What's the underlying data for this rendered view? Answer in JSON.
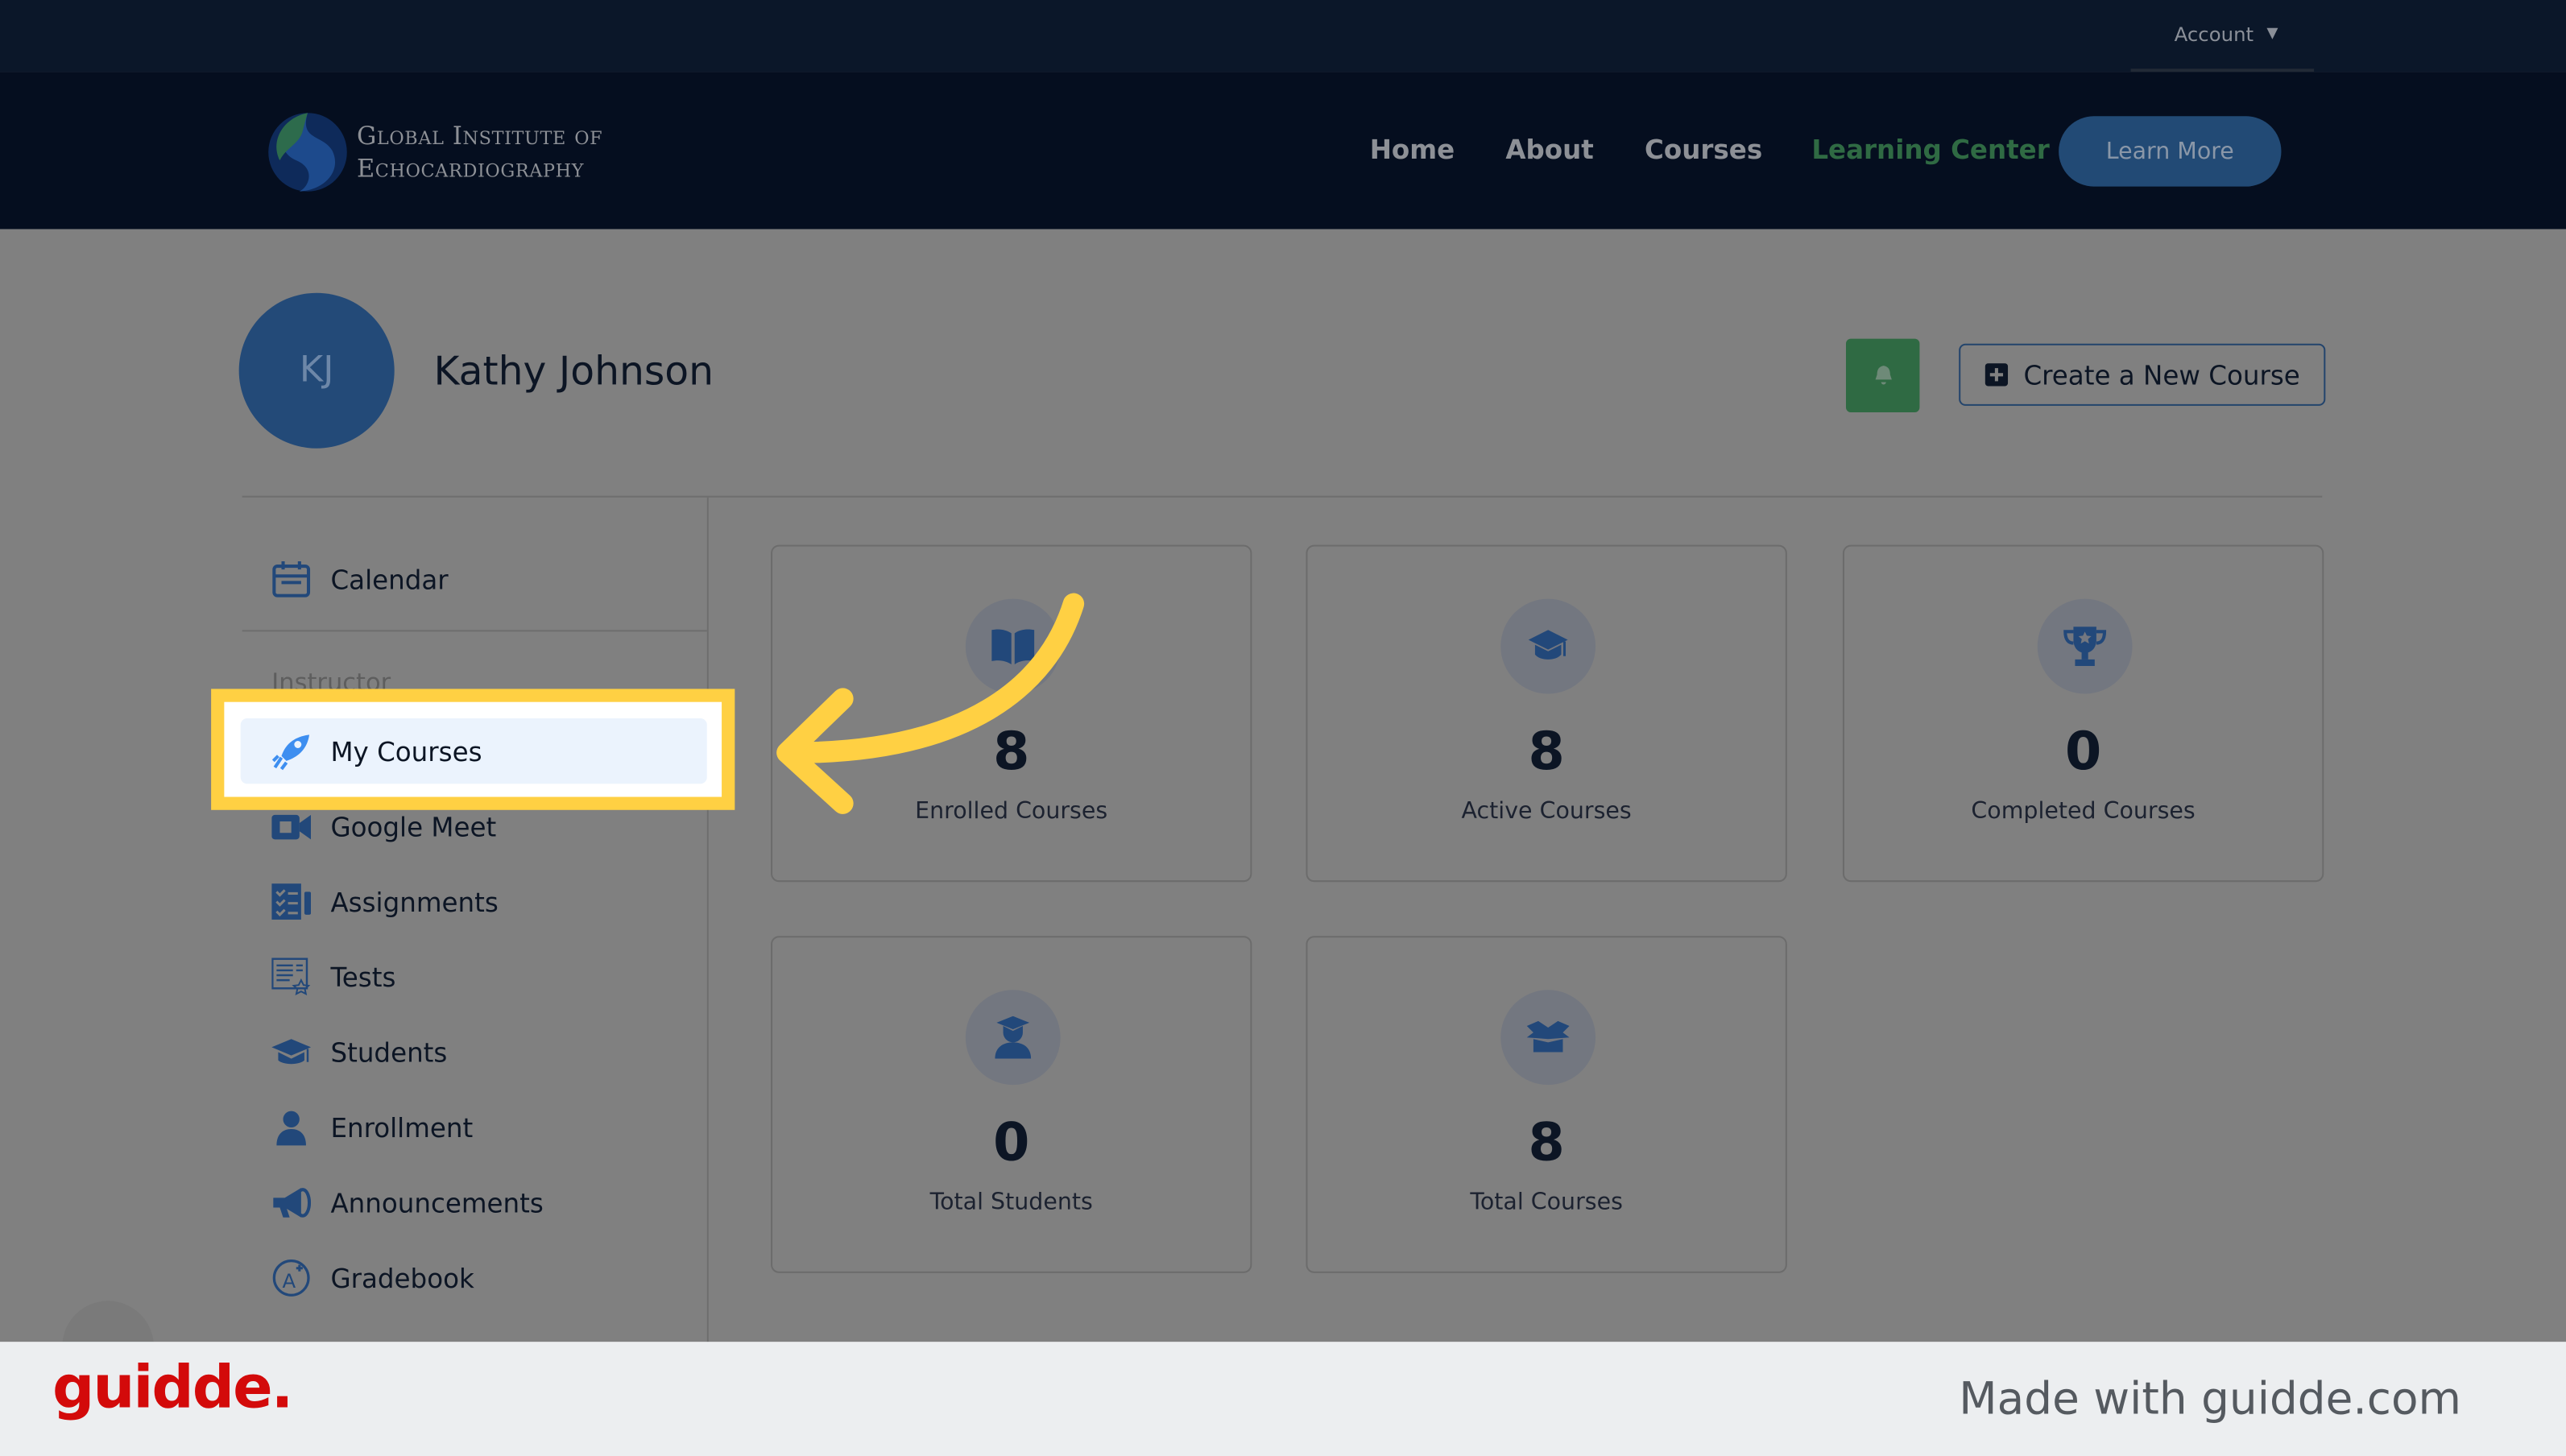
{
  "topbar": {
    "account_label": "Account"
  },
  "header": {
    "logo_line1": "Global Institute of",
    "logo_line2": "Echocardiography",
    "nav": [
      {
        "label": "Home"
      },
      {
        "label": "About"
      },
      {
        "label": "Courses"
      },
      {
        "label": "Learning Center",
        "active": true
      }
    ],
    "learn_more": "Learn More"
  },
  "profile": {
    "initials": "KJ",
    "name": "Kathy Johnson",
    "create_course": "Create a New Course"
  },
  "sidebar": {
    "calendar": "Calendar",
    "section": "Instructor",
    "items": [
      {
        "label": "My Courses",
        "icon": "rocket-icon",
        "selected": true
      },
      {
        "label": "Google Meet",
        "icon": "video-camera-icon"
      },
      {
        "label": "Assignments",
        "icon": "assignment-checklist-icon"
      },
      {
        "label": "Tests",
        "icon": "test-document-icon"
      },
      {
        "label": "Students",
        "icon": "graduation-cap-icon"
      },
      {
        "label": "Enrollment",
        "icon": "user-icon"
      },
      {
        "label": "Announcements",
        "icon": "megaphone-icon"
      },
      {
        "label": "Gradebook",
        "icon": "grade-a-plus-icon"
      }
    ]
  },
  "stats": [
    {
      "value": "8",
      "label": "Enrolled Courses",
      "icon": "book-open-icon"
    },
    {
      "value": "8",
      "label": "Active Courses",
      "icon": "graduation-cap-icon"
    },
    {
      "value": "0",
      "label": "Completed Courses",
      "icon": "trophy-icon"
    },
    {
      "value": "0",
      "label": "Total Students",
      "icon": "student-icon"
    },
    {
      "value": "8",
      "label": "Total Courses",
      "icon": "open-box-icon"
    }
  ],
  "footer": {
    "brand": "guidde.",
    "made_with": "Made with guidde.com"
  },
  "colors": {
    "accent_yellow": "#ffd043",
    "nav_active": "#2f6a43",
    "button_blue": "#224a75",
    "guidde_red": "#d30a0a"
  }
}
